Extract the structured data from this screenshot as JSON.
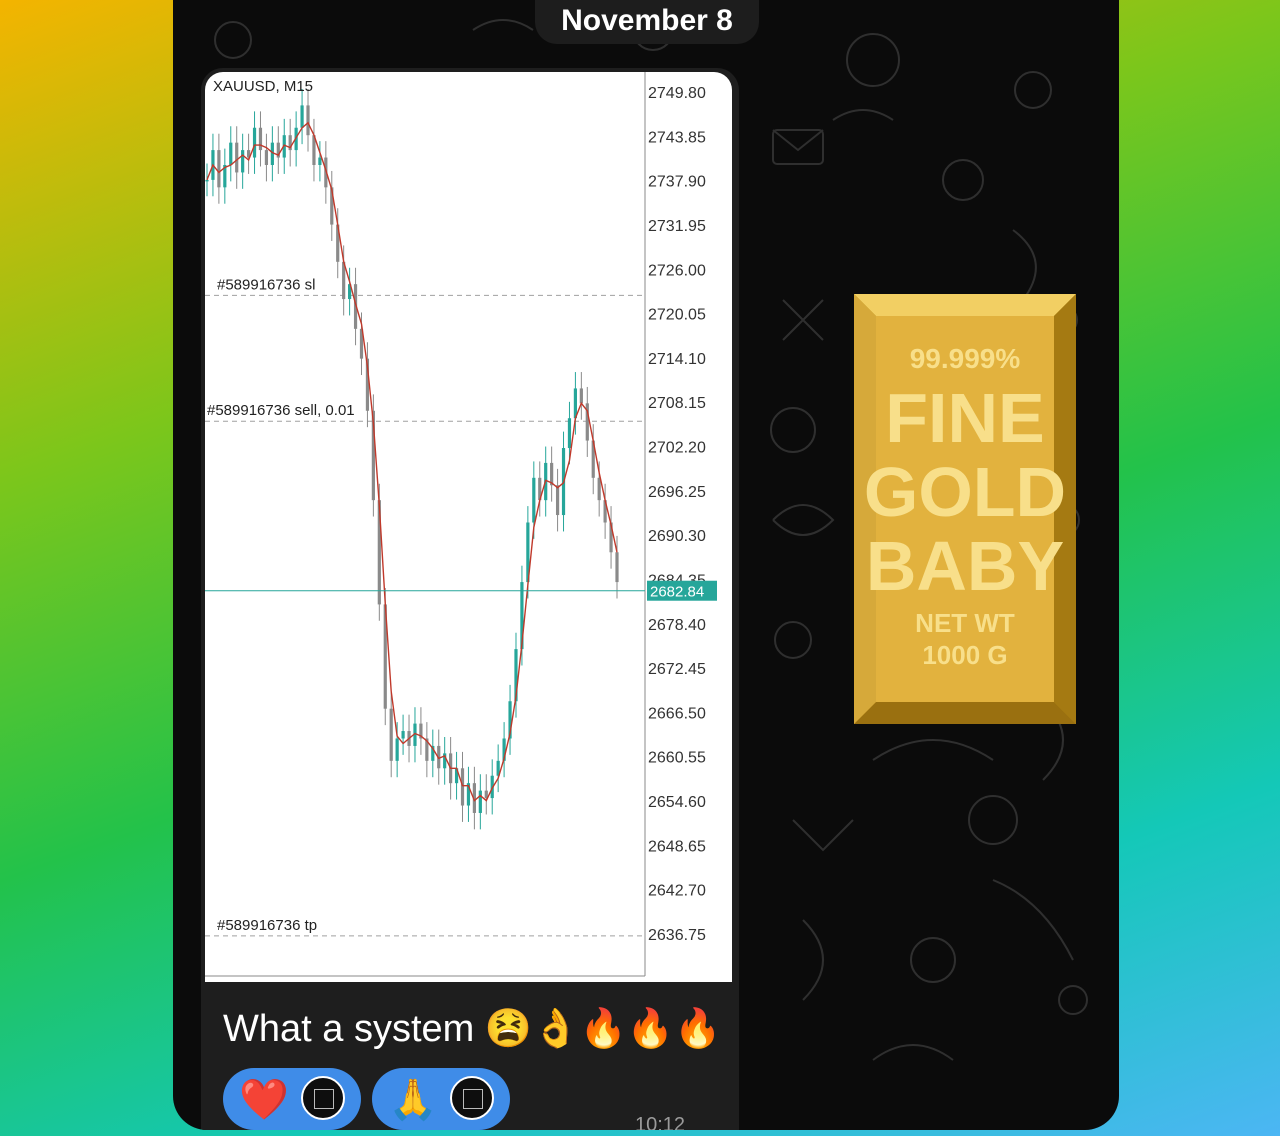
{
  "header": {
    "date": "November 8"
  },
  "chart": {
    "symbol_label": "XAUUSD, M15",
    "current_price": "2682.84",
    "ticks": [
      "2749.80",
      "2743.85",
      "2737.90",
      "2731.95",
      "2726.00",
      "2720.05",
      "2714.10",
      "2708.15",
      "2702.20",
      "2696.25",
      "2690.30",
      "2684.35",
      "2678.40",
      "2672.45",
      "2666.50",
      "2660.55",
      "2654.60",
      "2648.65",
      "2642.70",
      "2636.75"
    ],
    "order_sl_label": "#589916736 sl",
    "order_sell_label": "#589916736 sell, 0.01",
    "order_tp_label": "#589916736 tp",
    "colors": {
      "bull": "#26a69a",
      "bear": "#8a8a8a",
      "ma": "#c0392b",
      "price_tag": "#26a69a"
    }
  },
  "chart_data": {
    "type": "line",
    "title": "XAUUSD, M15",
    "xlabel": "",
    "ylabel": "",
    "ylim": [
      2632,
      2753
    ],
    "y_ticks": [
      2749.8,
      2743.85,
      2737.9,
      2731.95,
      2726.0,
      2720.05,
      2714.1,
      2708.15,
      2702.2,
      2696.25,
      2690.3,
      2684.35,
      2678.4,
      2672.45,
      2666.5,
      2660.55,
      2654.6,
      2648.65,
      2642.7,
      2636.75
    ],
    "current_price": 2682.84,
    "levels": [
      {
        "label": "#589916736 sl",
        "value": 2722.5
      },
      {
        "label": "#589916736 sell, 0.01",
        "value": 2705.6
      },
      {
        "label": "#589916736 tp",
        "value": 2636.5
      }
    ],
    "series": [
      {
        "values": [
          2738,
          2742,
          2737,
          2740,
          2743,
          2739,
          2742,
          2741,
          2745,
          2742,
          2740,
          2743,
          2741,
          2744,
          2742,
          2745,
          2748,
          2744,
          2740,
          2741,
          2737,
          2732,
          2727,
          2722,
          2724,
          2718,
          2714,
          2707,
          2695,
          2681,
          2667,
          2660,
          2663,
          2664,
          2662,
          2665,
          2663,
          2660,
          2662,
          2659,
          2661,
          2657,
          2659,
          2654,
          2657,
          2653,
          2656,
          2655,
          2658,
          2660,
          2663,
          2668,
          2675,
          2684,
          2692,
          2698,
          2695,
          2700,
          2697,
          2693,
          2702,
          2706,
          2710,
          2708,
          2703,
          2698,
          2695,
          2692,
          2688,
          2684
        ]
      }
    ]
  },
  "message": {
    "caption": "What a system 😫👌🔥🔥🔥",
    "time": "10:12"
  },
  "reactions": [
    {
      "emoji": "❤️"
    },
    {
      "emoji": "🙏"
    }
  ],
  "sticker": {
    "line1": "99.999%",
    "line2": "FINE",
    "line3": "GOLD",
    "line4": "BABY",
    "line5": "NET WT",
    "line6": "1000 G"
  }
}
